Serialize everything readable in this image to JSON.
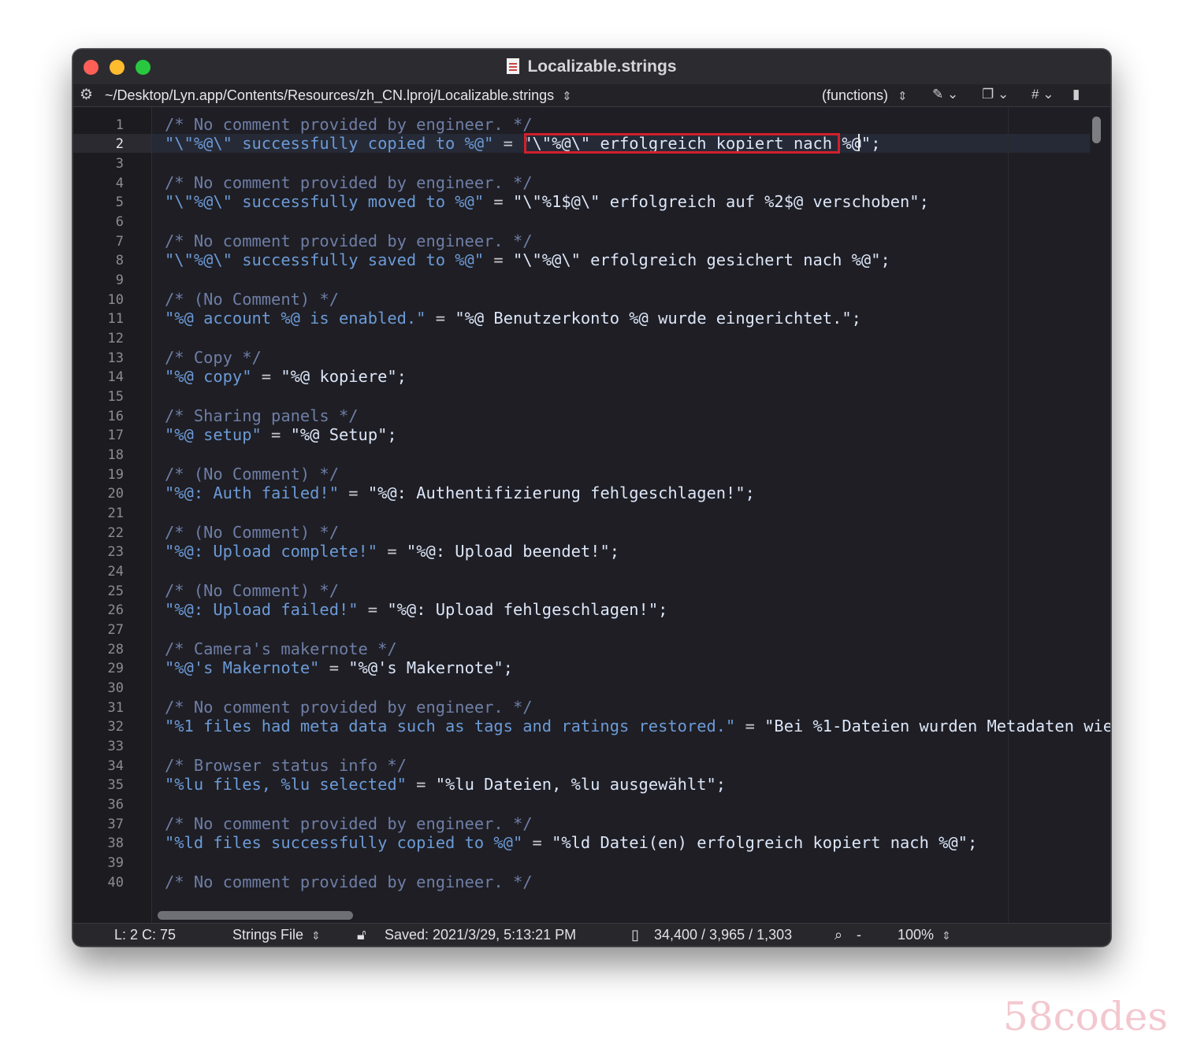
{
  "window": {
    "title": "Localizable.strings",
    "path": "~/Desktop/Lyn.app/Contents/Resources/zh_CN.lproj/Localizable.strings",
    "functions_label": "(functions)",
    "hash_label": "#"
  },
  "editor": {
    "current_line": 2,
    "highlight_line": 2,
    "line_numbers": [
      "1",
      "2",
      "3",
      "4",
      "5",
      "6",
      "7",
      "8",
      "9",
      "10",
      "11",
      "12",
      "13",
      "14",
      "15",
      "16",
      "17",
      "18",
      "19",
      "20",
      "21",
      "22",
      "23",
      "24",
      "25",
      "26",
      "27",
      "28",
      "29",
      "30",
      "31",
      "32",
      "33",
      "34",
      "35",
      "36",
      "37",
      "38",
      "39",
      "40"
    ],
    "lines": {
      "l1": {
        "comment": "/* No comment provided by engineer. */"
      },
      "l2": {
        "key": "\"\\\"%@\\\" successfully copied to %@\"",
        "eq": " = ",
        "val": "\"\\\"%@\\\" erfolgreich kopiert nach %@\";"
      },
      "l4": {
        "comment": "/* No comment provided by engineer. */"
      },
      "l5": {
        "key": "\"\\\"%@\\\" successfully moved to %@\"",
        "eq": " = ",
        "val": "\"\\\"%1$@\\\" erfolgreich auf %2$@ verschoben\";"
      },
      "l7": {
        "comment": "/* No comment provided by engineer. */"
      },
      "l8": {
        "key": "\"\\\"%@\\\" successfully saved to %@\"",
        "eq": " = ",
        "val": "\"\\\"%@\\\" erfolgreich gesichert nach %@\";"
      },
      "l10": {
        "comment": "/* (No Comment) */"
      },
      "l11": {
        "key": "\"%@ account %@ is enabled.\"",
        "eq": " = ",
        "val": "\"%@ Benutzerkonto %@ wurde eingerichtet.\";"
      },
      "l13": {
        "comment": "/* Copy */"
      },
      "l14": {
        "key": "\"%@ copy\"",
        "eq": " = ",
        "val": "\"%@ kopiere\";"
      },
      "l16": {
        "comment": "/* Sharing panels */"
      },
      "l17": {
        "key": "\"%@ setup\"",
        "eq": " = ",
        "val": "\"%@ Setup\";"
      },
      "l19": {
        "comment": "/* (No Comment) */"
      },
      "l20": {
        "key": "\"%@: Auth failed!\"",
        "eq": " = ",
        "val": "\"%@: Authentifizierung fehlgeschlagen!\";"
      },
      "l22": {
        "comment": "/* (No Comment) */"
      },
      "l23": {
        "key": "\"%@: Upload complete!\"",
        "eq": " = ",
        "val": "\"%@: Upload beendet!\";"
      },
      "l25": {
        "comment": "/* (No Comment) */"
      },
      "l26": {
        "key": "\"%@: Upload failed!\"",
        "eq": " = ",
        "val": "\"%@: Upload fehlgeschlagen!\";"
      },
      "l28": {
        "comment": "/* Camera's makernote */"
      },
      "l29": {
        "key": "\"%@'s Makernote\"",
        "eq": " = ",
        "val": "\"%@'s Makernote\";"
      },
      "l31": {
        "comment": "/* No comment provided by engineer. */"
      },
      "l32": {
        "key": "\"%1 files had meta data such as tags and ratings restored.\"",
        "eq": " = ",
        "val": "\"Bei %1-Dateien wurden Metadaten wie"
      },
      "l34": {
        "comment": "/* Browser status info */"
      },
      "l35": {
        "key": "\"%lu files, %lu selected\"",
        "eq": " = ",
        "val": "\"%lu Dateien, %lu ausgewählt\";"
      },
      "l37": {
        "comment": "/* No comment provided by engineer. */"
      },
      "l38": {
        "key": "\"%ld files successfully copied to %@\"",
        "eq": " = ",
        "val": "\"%ld Datei(en) erfolgreich kopiert nach %@\";"
      },
      "l40": {
        "comment": "/* No comment provided by engineer. */"
      }
    }
  },
  "status": {
    "position": "L: 2 C: 75",
    "file_type": "Strings File",
    "saved": "Saved: 2021/3/29, 5:13:21 PM",
    "counts": "34,400 / 3,965 / 1,303",
    "search": "-",
    "zoom": "100%"
  },
  "watermark": "58codes",
  "icons": [
    "gear-icon",
    "document-icon",
    "pen-icon",
    "copy-icon",
    "file-icon",
    "lock-icon",
    "search-icon",
    "updown-icon",
    "chevron-down-icon"
  ],
  "colors": {
    "background": "#1e1e24",
    "comment": "#6f7ea6",
    "key": "#6c9ad6",
    "value": "#dce6f8",
    "highlight_border": "#d21f2c",
    "close": "#ff5f57",
    "minimize": "#febc2e",
    "zoom": "#28c840"
  }
}
